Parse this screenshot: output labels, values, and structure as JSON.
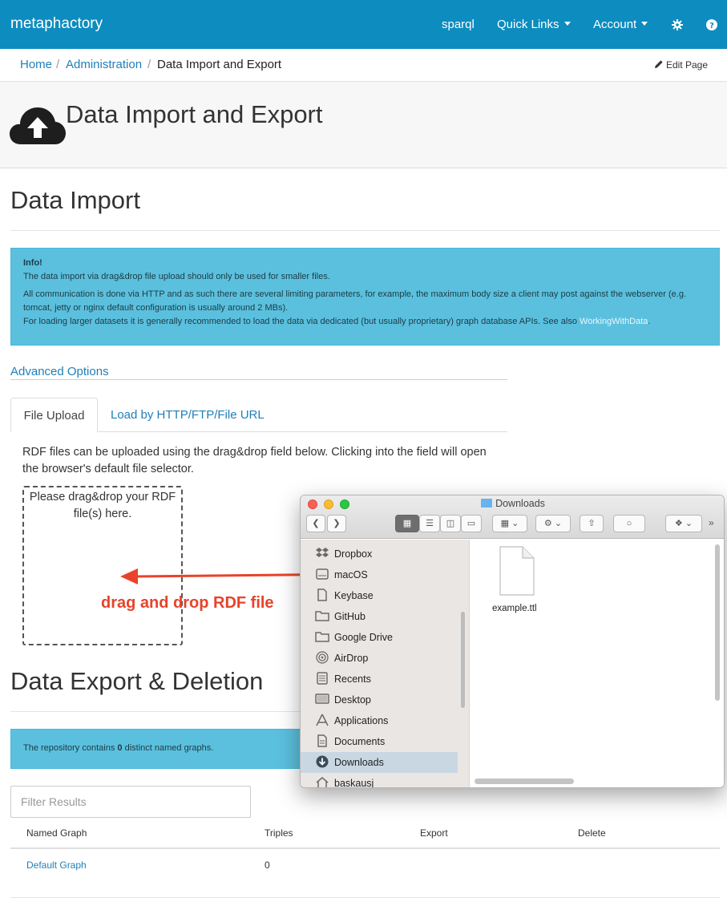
{
  "navbar": {
    "brand": "metaphactory",
    "links": [
      "sparql",
      "Quick Links",
      "Account"
    ],
    "settings_icon": "gear-icon",
    "help_icon": "help-icon"
  },
  "breadcrumb": {
    "items": [
      "Home",
      "Administration",
      "Data Import and Export"
    ],
    "separator": "/",
    "edit_page": "Edit Page"
  },
  "page": {
    "title": "Data Import and Export",
    "icon": "cloud-upload-icon"
  },
  "import": {
    "heading": "Data Import",
    "info_title": "Info!",
    "info_line1": "The data import via drag&drop file upload should only be used for smaller files.",
    "info_line2": "All communication is done via HTTP and as such there are several limiting parameters, for example, the maximum body size a client may post against the webserver (e.g. tomcat, jetty or nginx default configuration is usually around 2 MBs).",
    "info_line3": "For loading larger datasets it is generally recommended to load the data via dedicated (but usually proprietary) graph database APIs. See also",
    "info_link": "WorkingWithData",
    "info_end": ".",
    "advanced_options": "Advanced Options",
    "tabs": [
      "File Upload",
      "Load by HTTP/FTP/File URL"
    ],
    "upload_description": "RDF files can be uploaded using the drag&drop field below. Clicking into the field will open the browser's default file selector.",
    "dropzone_text": "Please drag&drop your RDF file(s) here."
  },
  "export": {
    "heading": "Data Export & Deletion",
    "info_pre": "The repository contains",
    "count": "0",
    "info_post": "distinct named graphs.",
    "filter_placeholder": "Filter Results",
    "columns": [
      "Named Graph",
      "Triples",
      "Export",
      "Delete"
    ],
    "rows": [
      {
        "graph": "Default Graph",
        "triples": "0"
      }
    ]
  },
  "finder": {
    "title": "Downloads",
    "sidebar": [
      "Dropbox",
      "macOS",
      "Keybase",
      "GitHub",
      "Google Drive",
      "AirDrop",
      "Recents",
      "Desktop",
      "Applications",
      "Documents",
      "Downloads",
      "baskausj"
    ],
    "selected": "Downloads",
    "file": "example.ttl"
  },
  "annotation": {
    "text": "drag and drop RDF file",
    "color": "#e8432a"
  },
  "colors": {
    "navbar": "#0d8cbf",
    "link": "#1f7fb8",
    "info": "#5bc0de"
  }
}
